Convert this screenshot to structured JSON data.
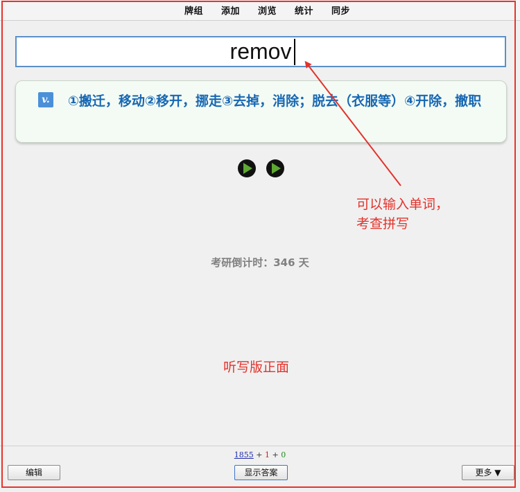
{
  "nav": [
    "牌组",
    "添加",
    "浏览",
    "统计",
    "同步"
  ],
  "input": {
    "value": "remov"
  },
  "card": {
    "pos": "v.",
    "meaning": "①搬迁，移动②移开，挪走③去掉，消除；脱去（衣服等）④开除，撤职"
  },
  "countdown": "考研倒计时：346 天",
  "annotations": {
    "arrow_note_line1": "可以输入单词，",
    "arrow_note_line2": "考查拼写",
    "mode_note": "听写版正面"
  },
  "counts": {
    "new": "1855",
    "plus1": "+",
    "learn": "1",
    "plus2": "+",
    "due": "0"
  },
  "buttons": {
    "edit": "编辑",
    "show_answer": "显示答案",
    "more": "更多 ▼"
  },
  "colors": {
    "annotation": "#e3322b",
    "meaning": "#1767b3",
    "badge": "#4a90d9",
    "play": "#5ea832"
  }
}
